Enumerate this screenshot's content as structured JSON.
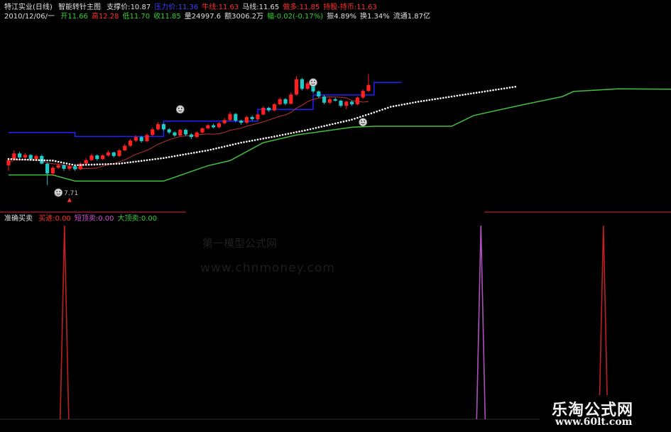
{
  "header": {
    "title": "特江实业(日线)",
    "indicator_name": "智能转针主图",
    "items": [
      {
        "label": "支撑价:",
        "value": "10.87",
        "color": "#e0e0e0"
      },
      {
        "label": "压力价:",
        "value": "11.36",
        "color": "#4040ff"
      },
      {
        "label": "牛线:",
        "value": "11.63",
        "color": "#ff3030"
      },
      {
        "label": "马线:",
        "value": "11.65",
        "color": "#e0e0e0"
      },
      {
        "label": "做多:",
        "value": "11.85",
        "color": "#ff3030"
      },
      {
        "label": "持股-持币:",
        "value": "11.63",
        "color": "#ff3030"
      }
    ],
    "quote_date": "2010/12/06/一",
    "quote_items": [
      {
        "label": "开",
        "value": "11.66",
        "color": "#30d030"
      },
      {
        "label": "高",
        "value": "12.28",
        "color": "#ff3030"
      },
      {
        "label": "低",
        "value": "11.70",
        "color": "#30d030"
      },
      {
        "label": "收",
        "value": "11.85",
        "color": "#30d030"
      },
      {
        "label": "量",
        "value": "24997.6",
        "color": "#e0e0e0"
      },
      {
        "label": "额",
        "value": "3006.2万",
        "color": "#e0e0e0"
      },
      {
        "label": "幅",
        "value": "-0.02(-0.17%)",
        "color": "#30d030"
      },
      {
        "label": "振",
        "value": "4.89%",
        "color": "#e0e0e0"
      },
      {
        "label": "换",
        "value": "1.34%",
        "color": "#e0e0e0"
      },
      {
        "label": "流通",
        "value": "1.87亿",
        "color": "#e0e0e0"
      }
    ]
  },
  "indicator": {
    "title": "准确买卖",
    "items": [
      {
        "label": "买进:",
        "value": "0.00",
        "color": "#ff3030"
      },
      {
        "label": "短顶卖:",
        "value": "0.00",
        "color": "#d050d0"
      },
      {
        "label": "大顶卖:",
        "value": "0.00",
        "color": "#30d030"
      }
    ]
  },
  "low_marker_label": "7.71",
  "watermark": {
    "line1": "第一模型公式网",
    "line2": "www.chnmoney.com"
  },
  "logo": {
    "line1": "乐淘公式网",
    "line2": "www.60lt.com"
  },
  "colors": {
    "up": "#ff2020",
    "down": "#20c8c8",
    "resistance": "#2020ff",
    "support": "#40c040",
    "ma": "#c03030",
    "dots": "#ffffff",
    "buy": "#c02020",
    "sell_small": "#b050c0",
    "divider": "#8b1a2a"
  },
  "chart_data": [
    {
      "type": "candlestick",
      "price_range": [
        7.0,
        12.4
      ],
      "candles": [
        {
          "o": 8.72,
          "c": 8.92,
          "h": 9.0,
          "l": 8.5
        },
        {
          "o": 8.95,
          "c": 9.18,
          "h": 9.3,
          "l": 8.9
        },
        {
          "o": 9.18,
          "c": 9.02,
          "h": 9.25,
          "l": 8.95
        },
        {
          "o": 9.02,
          "c": 9.12,
          "h": 9.2,
          "l": 8.98
        },
        {
          "o": 9.12,
          "c": 8.96,
          "h": 9.15,
          "l": 8.9
        },
        {
          "o": 8.96,
          "c": 9.08,
          "h": 9.14,
          "l": 8.92
        },
        {
          "o": 9.08,
          "c": 8.78,
          "h": 9.14,
          "l": 8.76
        },
        {
          "o": 8.78,
          "c": 8.4,
          "h": 8.82,
          "l": 7.95
        },
        {
          "o": 8.4,
          "c": 8.62,
          "h": 8.68,
          "l": 8.3
        },
        {
          "o": 8.62,
          "c": 8.72,
          "h": 8.78,
          "l": 8.58
        },
        {
          "o": 8.72,
          "c": 8.58,
          "h": 8.76,
          "l": 8.5
        },
        {
          "o": 8.58,
          "c": 8.68,
          "h": 8.72,
          "l": 8.5
        },
        {
          "o": 8.68,
          "c": 8.56,
          "h": 8.7,
          "l": 8.5
        },
        {
          "o": 8.56,
          "c": 8.78,
          "h": 8.82,
          "l": 8.52
        },
        {
          "o": 8.78,
          "c": 8.92,
          "h": 9.0,
          "l": 8.74
        },
        {
          "o": 8.92,
          "c": 9.1,
          "h": 9.16,
          "l": 8.88
        },
        {
          "o": 9.1,
          "c": 8.96,
          "h": 9.14,
          "l": 8.9
        },
        {
          "o": 8.96,
          "c": 9.1,
          "h": 9.14,
          "l": 8.92
        },
        {
          "o": 9.1,
          "c": 9.22,
          "h": 9.3,
          "l": 9.05
        },
        {
          "o": 9.22,
          "c": 9.08,
          "h": 9.25,
          "l": 9.02
        },
        {
          "o": 9.08,
          "c": 9.3,
          "h": 9.36,
          "l": 9.04
        },
        {
          "o": 9.3,
          "c": 9.48,
          "h": 9.55,
          "l": 9.26
        },
        {
          "o": 9.48,
          "c": 9.68,
          "h": 9.74,
          "l": 9.44
        },
        {
          "o": 9.68,
          "c": 9.82,
          "h": 9.88,
          "l": 9.62
        },
        {
          "o": 9.82,
          "c": 9.66,
          "h": 9.86,
          "l": 9.6
        },
        {
          "o": 9.66,
          "c": 9.9,
          "h": 9.96,
          "l": 9.62
        },
        {
          "o": 9.9,
          "c": 10.12,
          "h": 10.2,
          "l": 9.86
        },
        {
          "o": 10.12,
          "c": 10.32,
          "h": 10.4,
          "l": 10.08
        },
        {
          "o": 10.32,
          "c": 10.12,
          "h": 10.36,
          "l": 10.06
        },
        {
          "o": 10.12,
          "c": 10.0,
          "h": 10.16,
          "l": 9.94
        },
        {
          "o": 10.0,
          "c": 9.88,
          "h": 10.04,
          "l": 9.82
        },
        {
          "o": 9.88,
          "c": 10.1,
          "h": 10.14,
          "l": 9.84
        },
        {
          "o": 10.1,
          "c": 9.92,
          "h": 10.14,
          "l": 9.86
        },
        {
          "o": 9.92,
          "c": 9.82,
          "h": 9.96,
          "l": 9.74
        },
        {
          "o": 9.82,
          "c": 10.0,
          "h": 10.04,
          "l": 9.78
        },
        {
          "o": 10.0,
          "c": 10.16,
          "h": 10.2,
          "l": 9.96
        },
        {
          "o": 10.16,
          "c": 10.28,
          "h": 10.32,
          "l": 10.12
        },
        {
          "o": 10.28,
          "c": 10.2,
          "h": 10.34,
          "l": 10.16
        },
        {
          "o": 10.2,
          "c": 10.36,
          "h": 10.4,
          "l": 10.16
        },
        {
          "o": 10.36,
          "c": 10.48,
          "h": 10.56,
          "l": 10.32
        },
        {
          "o": 10.48,
          "c": 10.72,
          "h": 10.8,
          "l": 10.44
        },
        {
          "o": 10.72,
          "c": 10.46,
          "h": 10.76,
          "l": 10.4
        },
        {
          "o": 10.46,
          "c": 10.38,
          "h": 10.5,
          "l": 10.3
        },
        {
          "o": 10.38,
          "c": 10.6,
          "h": 10.64,
          "l": 10.34
        },
        {
          "o": 10.6,
          "c": 10.52,
          "h": 10.66,
          "l": 10.46
        },
        {
          "o": 10.52,
          "c": 10.7,
          "h": 10.74,
          "l": 10.48
        },
        {
          "o": 10.7,
          "c": 10.96,
          "h": 11.02,
          "l": 10.66
        },
        {
          "o": 10.96,
          "c": 10.86,
          "h": 11.0,
          "l": 10.8
        },
        {
          "o": 10.86,
          "c": 11.1,
          "h": 11.14,
          "l": 10.82
        },
        {
          "o": 11.1,
          "c": 11.3,
          "h": 11.36,
          "l": 11.06
        },
        {
          "o": 11.3,
          "c": 11.12,
          "h": 11.34,
          "l": 11.06
        },
        {
          "o": 11.12,
          "c": 11.48,
          "h": 11.56,
          "l": 11.08
        },
        {
          "o": 11.48,
          "c": 12.08,
          "h": 12.2,
          "l": 11.44
        },
        {
          "o": 12.08,
          "c": 11.7,
          "h": 12.12,
          "l": 11.64
        },
        {
          "o": 11.7,
          "c": 11.92,
          "h": 11.98,
          "l": 11.66
        },
        {
          "o": 11.92,
          "c": 11.6,
          "h": 11.96,
          "l": 11.52
        },
        {
          "o": 11.6,
          "c": 11.4,
          "h": 11.64,
          "l": 11.34
        },
        {
          "o": 11.4,
          "c": 11.16,
          "h": 11.46,
          "l": 11.1
        },
        {
          "o": 11.16,
          "c": 11.3,
          "h": 11.34,
          "l": 11.12
        },
        {
          "o": 11.3,
          "c": 11.24,
          "h": 11.36,
          "l": 11.2
        },
        {
          "o": 11.24,
          "c": 11.04,
          "h": 11.28,
          "l": 10.98
        },
        {
          "o": 11.04,
          "c": 11.2,
          "h": 11.24,
          "l": 10.9
        },
        {
          "o": 11.2,
          "c": 11.1,
          "h": 11.24,
          "l": 11.04
        },
        {
          "o": 11.1,
          "c": 11.36,
          "h": 11.4,
          "l": 11.06
        },
        {
          "o": 11.36,
          "c": 11.62,
          "h": 11.68,
          "l": 11.32
        },
        {
          "o": 11.62,
          "c": 11.85,
          "h": 12.28,
          "l": 11.58
        }
      ],
      "resistance_line": [
        [
          0,
          10.0
        ],
        [
          12,
          10.0
        ],
        [
          12,
          9.84
        ],
        [
          28,
          9.84
        ],
        [
          28,
          10.44
        ],
        [
          45,
          10.44
        ],
        [
          45,
          10.9
        ],
        [
          55,
          10.9
        ],
        [
          55,
          11.46
        ],
        [
          66,
          11.46
        ],
        [
          66,
          11.95
        ],
        [
          71,
          11.95
        ]
      ],
      "support_line": [
        [
          0,
          8.34
        ],
        [
          8,
          8.34
        ],
        [
          12,
          8.1
        ],
        [
          28,
          8.1
        ],
        [
          32,
          8.4
        ],
        [
          36,
          8.7
        ],
        [
          40,
          8.9
        ],
        [
          46,
          9.6
        ],
        [
          52,
          9.9
        ],
        [
          62,
          10.2
        ],
        [
          66,
          10.24
        ],
        [
          80,
          10.24
        ],
        [
          84,
          10.66
        ],
        [
          92,
          11.04
        ],
        [
          100,
          11.4
        ],
        [
          102,
          11.6
        ],
        [
          110,
          11.7
        ],
        [
          126,
          11.68
        ],
        [
          135,
          11.66
        ]
      ],
      "trail_dots": [
        [
          0,
          8.96
        ],
        [
          8,
          8.9
        ],
        [
          12,
          8.72
        ],
        [
          20,
          8.78
        ],
        [
          28,
          9.0
        ],
        [
          36,
          9.3
        ],
        [
          42,
          9.6
        ],
        [
          48,
          9.84
        ],
        [
          54,
          10.1
        ],
        [
          58,
          10.3
        ],
        [
          62,
          10.5
        ],
        [
          66,
          10.78
        ],
        [
          69,
          11.0
        ],
        [
          74,
          11.2
        ],
        [
          80,
          11.4
        ],
        [
          86,
          11.6
        ],
        [
          92,
          11.8
        ]
      ],
      "markers": [
        {
          "type": "face",
          "at": 9,
          "price": 7.65
        },
        {
          "type": "arrow",
          "at": 11,
          "price": 7.45
        },
        {
          "type": "face",
          "at": 31,
          "price": 10.9
        },
        {
          "type": "face",
          "at": 55,
          "price": 11.95
        },
        {
          "type": "face",
          "at": 64,
          "price": 10.4
        }
      ]
    },
    {
      "type": "line",
      "title": "准确买卖",
      "x_count": 135,
      "series": [
        {
          "name": "买进",
          "color": "#c02020",
          "spikes": [
            [
              12,
              1
            ],
            [
              122,
              1
            ]
          ]
        },
        {
          "name": "短顶卖",
          "color": "#b050c0",
          "spikes": [
            [
              97,
              1
            ]
          ]
        },
        {
          "name": "大顶卖",
          "color": "#30d030",
          "spikes": []
        }
      ],
      "ylim": [
        0,
        1
      ]
    }
  ]
}
